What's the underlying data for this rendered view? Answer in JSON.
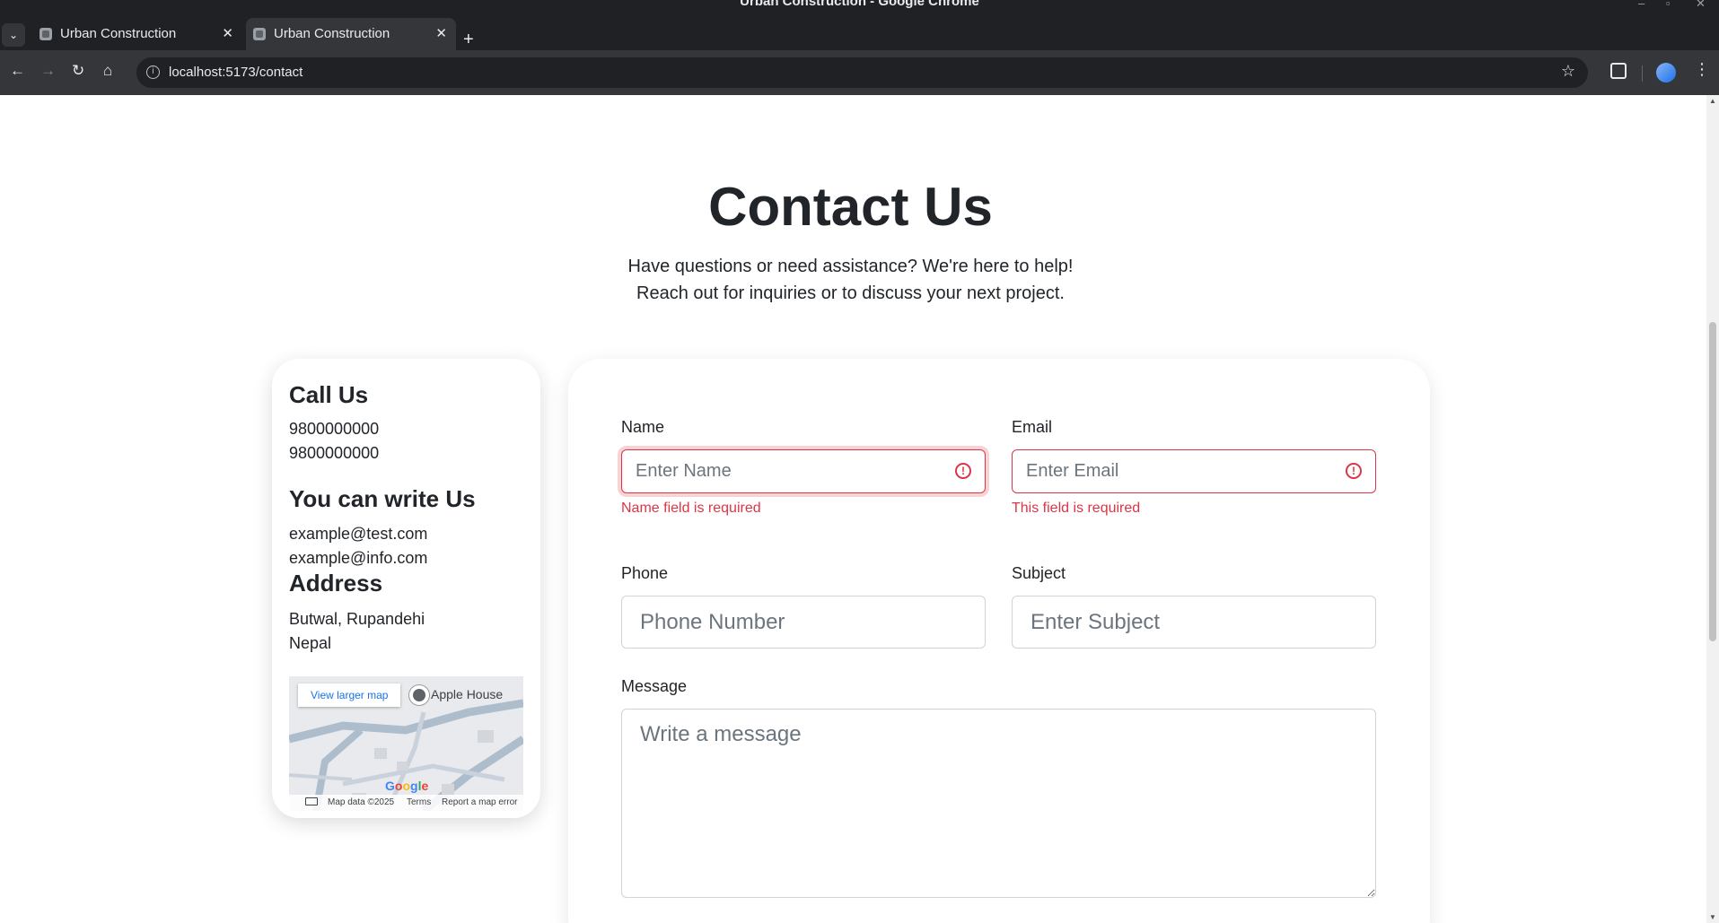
{
  "window": {
    "title": "Urban Construction - Google Chrome"
  },
  "tabs": [
    {
      "label": "Urban Construction",
      "active": false
    },
    {
      "label": "Urban Construction",
      "active": true
    }
  ],
  "address_bar": {
    "url": "localhost:5173/contact"
  },
  "hero": {
    "title": "Contact Us",
    "subtitle_line1": "Have questions or need assistance? We're here to help!",
    "subtitle_line2": "Reach out for inquiries or to discuss your next project."
  },
  "info": {
    "call_heading": "Call Us",
    "phones": [
      "9800000000",
      "9800000000"
    ],
    "write_heading": "You can write Us",
    "emails": [
      "example@test.com",
      "example@info.com"
    ],
    "address_heading": "Address",
    "address_lines": [
      "Butwal, Rupandehi",
      "Nepal"
    ],
    "map": {
      "view_larger": "View larger map",
      "place": "Apple House",
      "logo": "Google",
      "map_data": "Map data ©2025",
      "terms": "Terms",
      "report": "Report a map error"
    }
  },
  "form": {
    "name": {
      "label": "Name",
      "placeholder": "Enter Name",
      "value": "",
      "error": "Name field is required"
    },
    "email": {
      "label": "Email",
      "placeholder": "Enter Email",
      "value": "",
      "error": "This field is required"
    },
    "phone": {
      "label": "Phone",
      "placeholder": "Phone Number",
      "value": ""
    },
    "subject": {
      "label": "Subject",
      "placeholder": "Enter Subject",
      "value": ""
    },
    "message": {
      "label": "Message",
      "placeholder": "Write a message",
      "value": ""
    }
  },
  "colors": {
    "error": "#dc3545",
    "text": "#212529",
    "link": "#1a73e8"
  }
}
